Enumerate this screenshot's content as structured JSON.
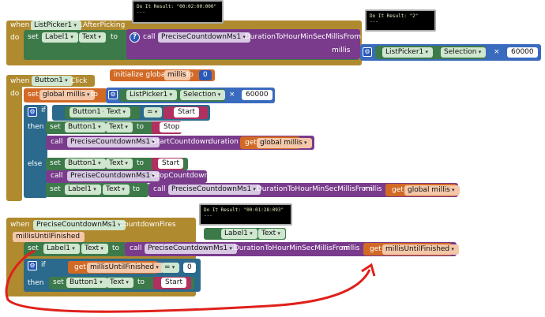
{
  "bubbles": {
    "b1": "Do It Result: \"00:02:00:000\"\n---",
    "b2": "Do It Result: \"2\"\n---",
    "b3": "Do It Result: \"00:01:28:093\"\n---"
  },
  "kw": {
    "when": "when",
    "do": "do",
    "set": "set",
    "to": "to",
    "call": "call",
    "if": "if",
    "then": "then",
    "else": "else",
    "get": "get",
    "millis": "millis",
    "duration": "duration",
    "dot": ".",
    "times": "×",
    "eq": "=",
    "init": "initialize global",
    "q": "?",
    "gear": "⚙"
  },
  "ev1": {
    "component": "ListPicker1",
    "event": ".AfterPicking",
    "label": "Label1",
    "prop": "Text",
    "comp": "PreciseCountdownMs1",
    "method": ".DurationToHourMinSecMillisFrom",
    "lp": "ListPicker1",
    "sel": "Selection",
    "mult": "60000"
  },
  "init": {
    "name": "millis",
    "value": "0"
  },
  "ev2": {
    "component": "Button1",
    "event": ".Click",
    "setvar": "global millis",
    "lp": "ListPicker1",
    "sel": "Selection",
    "mult": "60000",
    "btn": "Button1",
    "prop": "Text",
    "start": "Start",
    "stop": "Stop",
    "comp": "PreciseCountdownMs1",
    "startcd": ".StartCountdown",
    "stopcd": ".StopCountdown",
    "getvar": "global millis",
    "label": "Label1",
    "method": ".DurationToHourMinSecMillisFrom"
  },
  "ev3": {
    "component": "PreciseCountdownMs1",
    "event": ".CountdownFires",
    "param": "millisUntilFinished",
    "label": "Label1",
    "prop": "Text",
    "comp": "PreciseCountdownMs1",
    "method": ".DurationToHourMinSecMillisFrom",
    "getvar": "millisUntilFinished",
    "zero": "0",
    "btn": "Button1",
    "start": "Start",
    "floatlabel": "Label1",
    "floatprop": "Text"
  },
  "colors": {
    "event": "#b08a2e",
    "procedure": "#7a3b8c",
    "arrow": "#e0201a"
  }
}
